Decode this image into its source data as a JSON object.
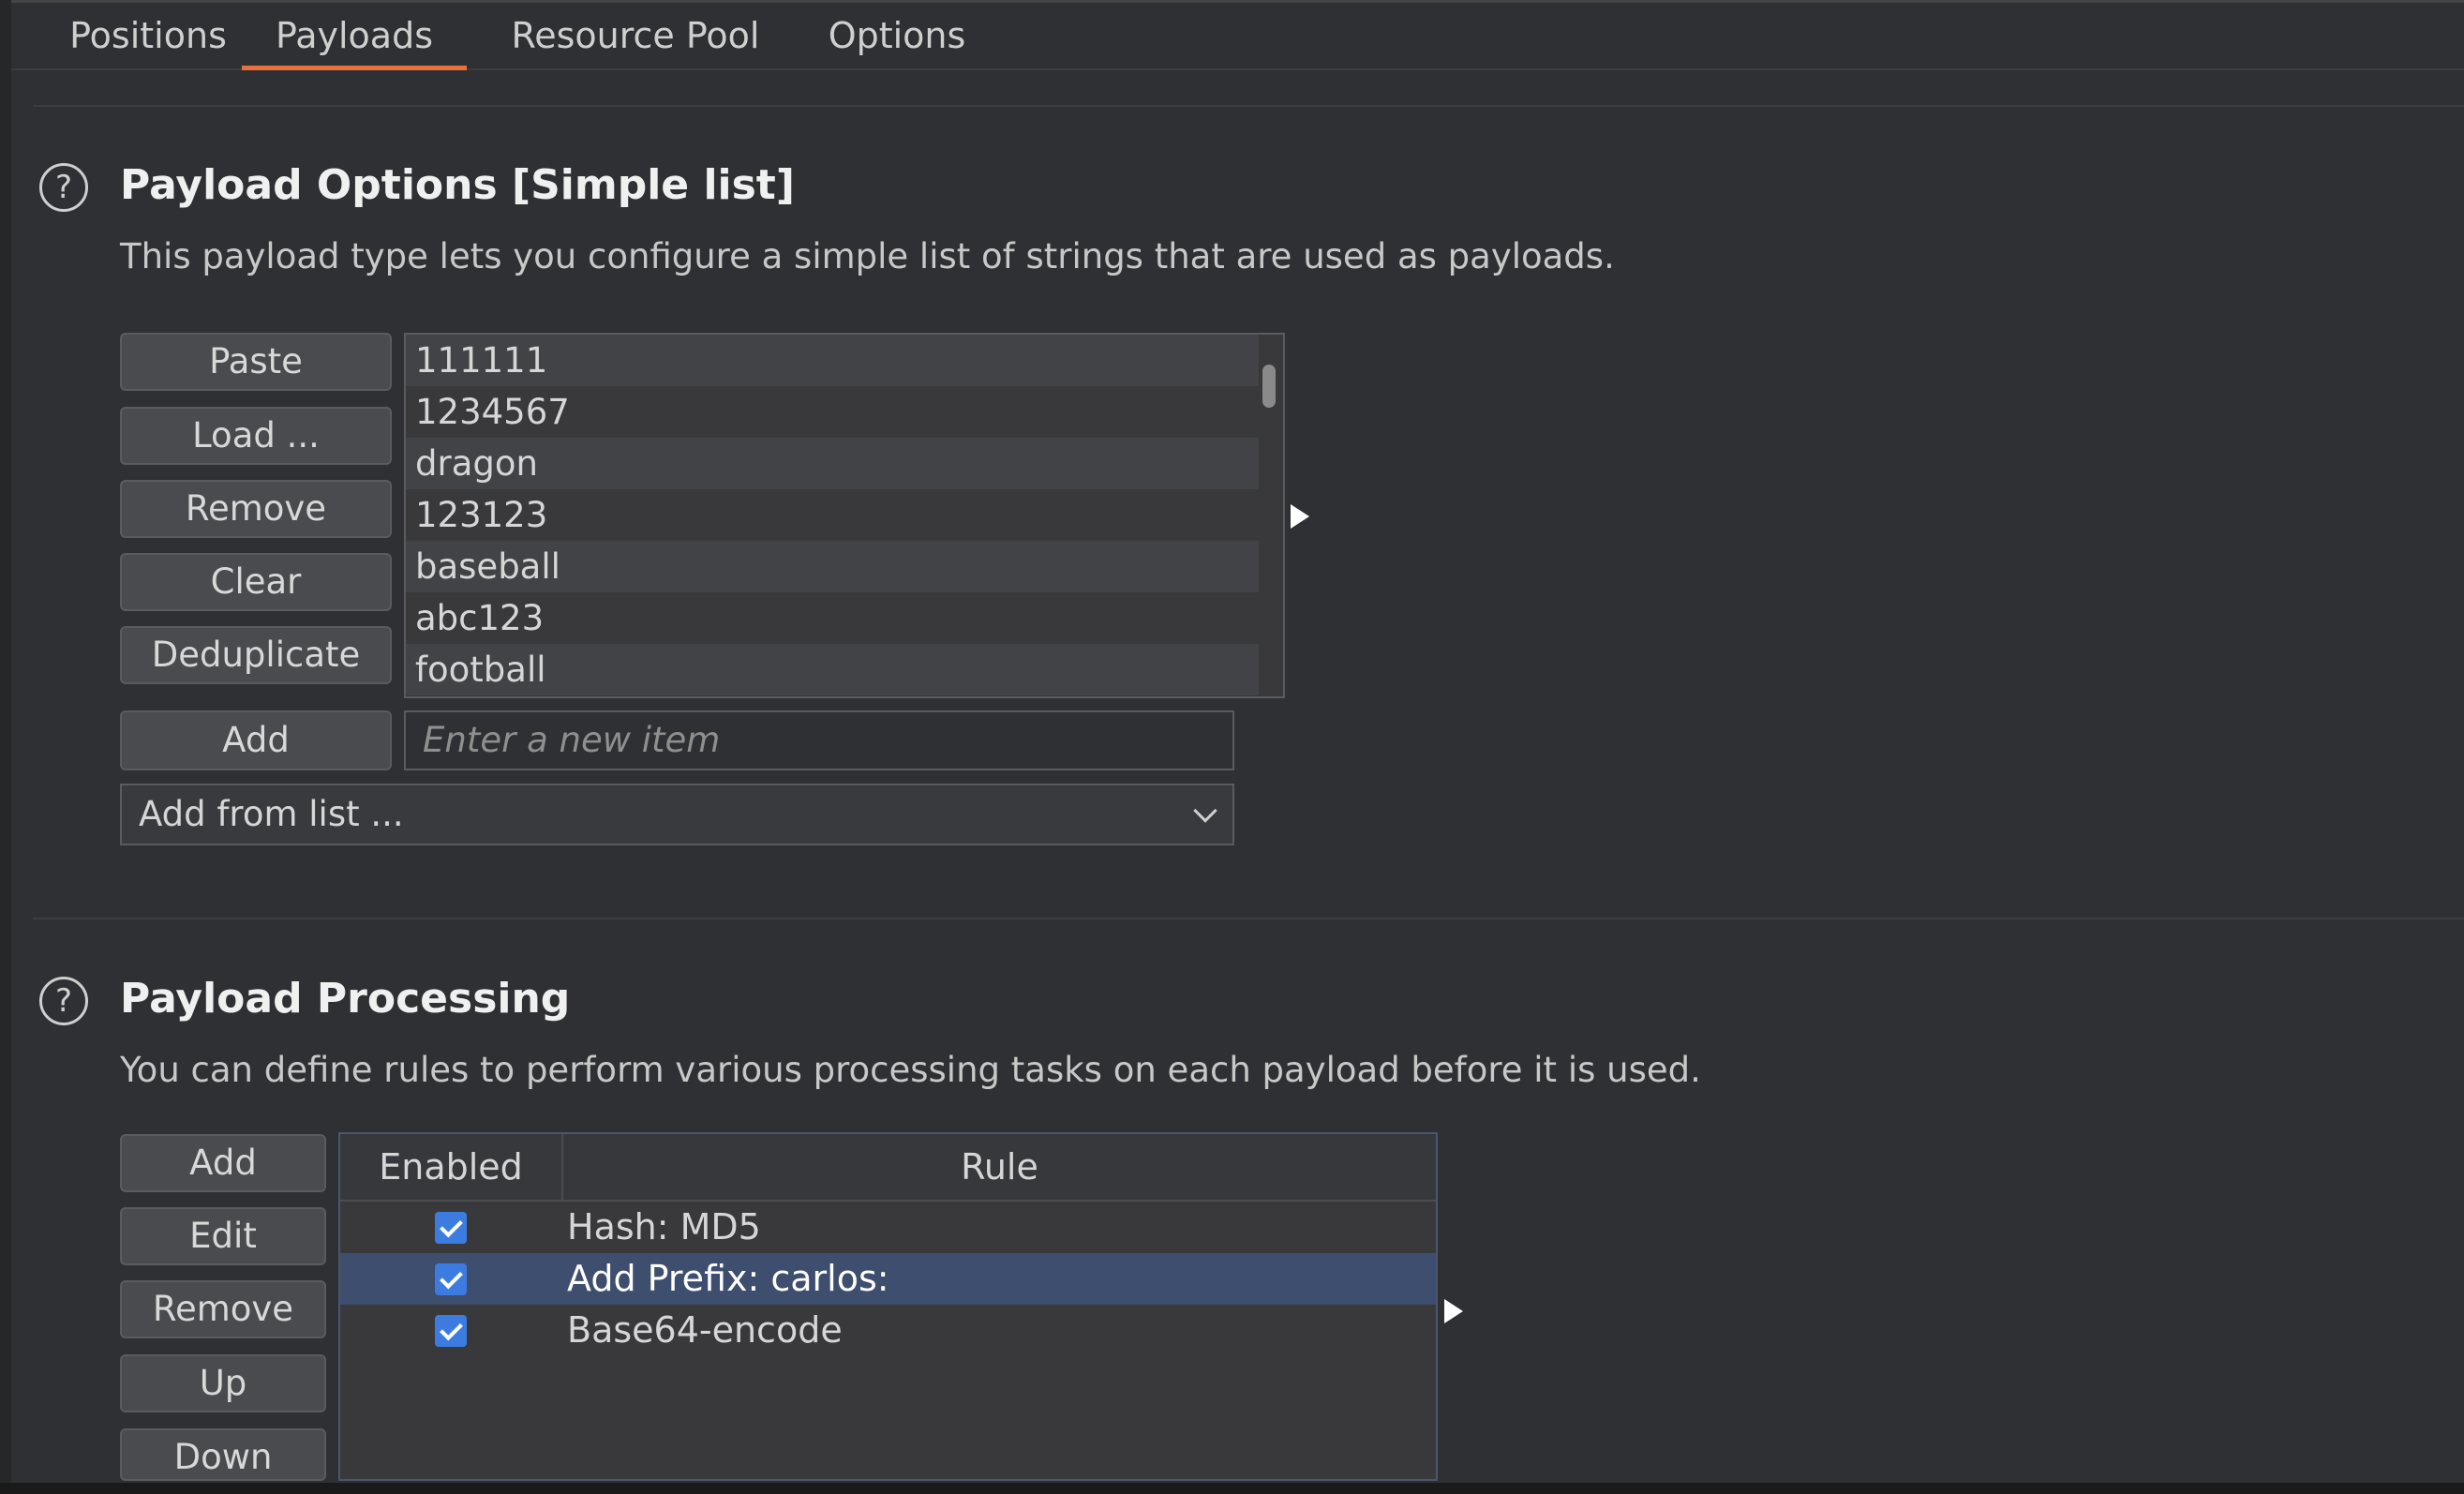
{
  "tabs": [
    "Positions",
    "Payloads",
    "Resource Pool",
    "Options"
  ],
  "active_tab": "Payloads",
  "payload_options": {
    "title": "Payload Options [Simple list]",
    "description": "This payload type lets you configure a simple list of strings that are used as payloads.",
    "buttons": [
      "Paste",
      "Load ...",
      "Remove",
      "Clear",
      "Deduplicate"
    ],
    "items": [
      "111111",
      "1234567",
      "dragon",
      "123123",
      "baseball",
      "abc123",
      "football"
    ],
    "add_label": "Add",
    "new_item_placeholder": "Enter a new item",
    "add_from_list": "Add from list ..."
  },
  "payload_processing": {
    "title": "Payload Processing",
    "description": "You can define rules to perform various processing tasks on each payload before it is used.",
    "buttons": [
      "Add",
      "Edit",
      "Remove",
      "Up",
      "Down"
    ],
    "columns": [
      "Enabled",
      "Rule"
    ],
    "rules": [
      {
        "enabled": true,
        "rule": "Hash: MD5"
      },
      {
        "enabled": true,
        "rule": "Add Prefix: carlos:"
      },
      {
        "enabled": true,
        "rule": "Base64-encode"
      }
    ],
    "selected_rule": "Add Prefix: carlos:"
  },
  "colors": {
    "background": "#2f3033",
    "accent_tab": "#e9703a",
    "selection": "#3e4e6e",
    "checkbox": "#3c7ce0"
  }
}
